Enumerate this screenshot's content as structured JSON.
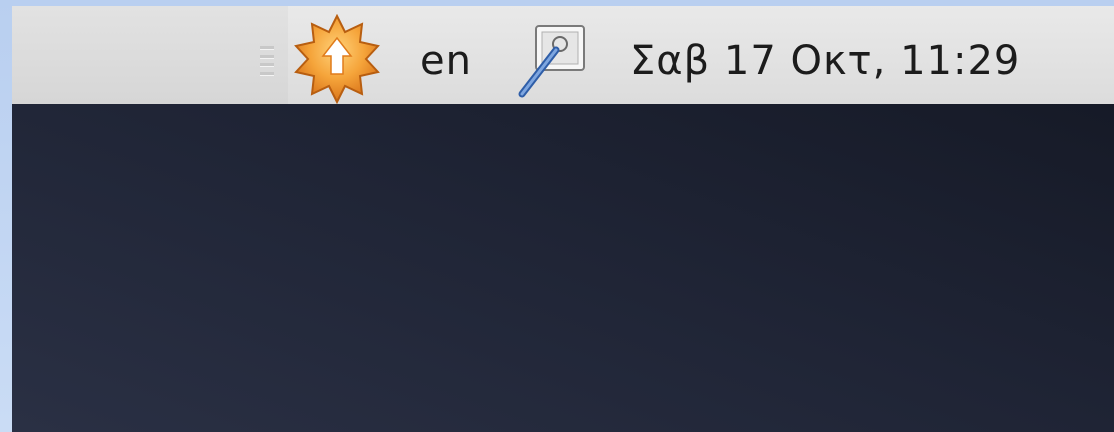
{
  "panel": {
    "tray": {
      "update_icon": "software-update-star-icon",
      "keyboard_layout": "en",
      "screenshot_icon": "screenshot-pen-icon"
    },
    "clock": {
      "text": "Σαβ 17 Οκτ, 11:29"
    }
  },
  "colors": {
    "panel_background": "#e4e4e4",
    "desktop_background": "#1f2435",
    "frame_background": "#c2d6f3",
    "update_icon_fill": "#f2a23a",
    "update_arrow": "#ffffff"
  }
}
